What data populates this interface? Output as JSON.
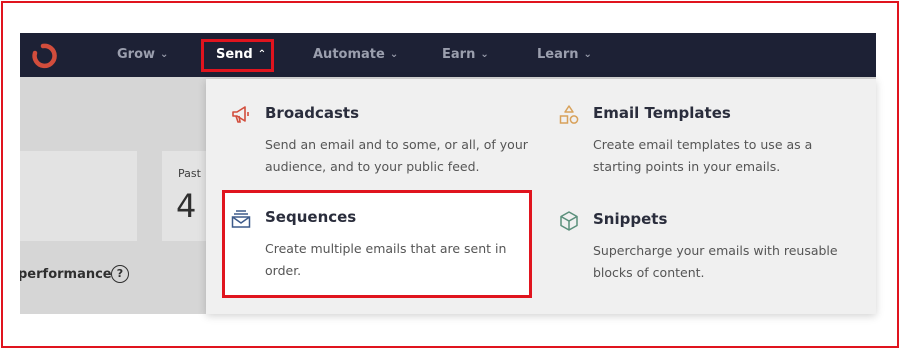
{
  "nav": {
    "items": [
      {
        "label": "Grow"
      },
      {
        "label": "Send"
      },
      {
        "label": "Automate"
      },
      {
        "label": "Earn"
      },
      {
        "label": "Learn"
      }
    ]
  },
  "background": {
    "past_label": "Past",
    "past_value": "4",
    "performance_label": "performance",
    "help_glyph": "?"
  },
  "dropdown": {
    "broadcasts": {
      "title": "Broadcasts",
      "desc": "Send an email and to some, or all, of your audience, and to your public feed.",
      "icon": "megaphone-icon"
    },
    "email_templates": {
      "title": "Email Templates",
      "desc": "Create email templates to use as a starting points in your emails.",
      "icon": "shapes-icon"
    },
    "sequences": {
      "title": "Sequences",
      "desc": "Create multiple emails that are sent in order.",
      "icon": "mail-stack-icon"
    },
    "snippets": {
      "title": "Snippets",
      "desc": "Supercharge your emails with reusable blocks of content.",
      "icon": "cube-icon"
    }
  },
  "colors": {
    "nav_bg": "#1d2135",
    "highlight": "#e0141e",
    "accent": "#d24d3c"
  }
}
